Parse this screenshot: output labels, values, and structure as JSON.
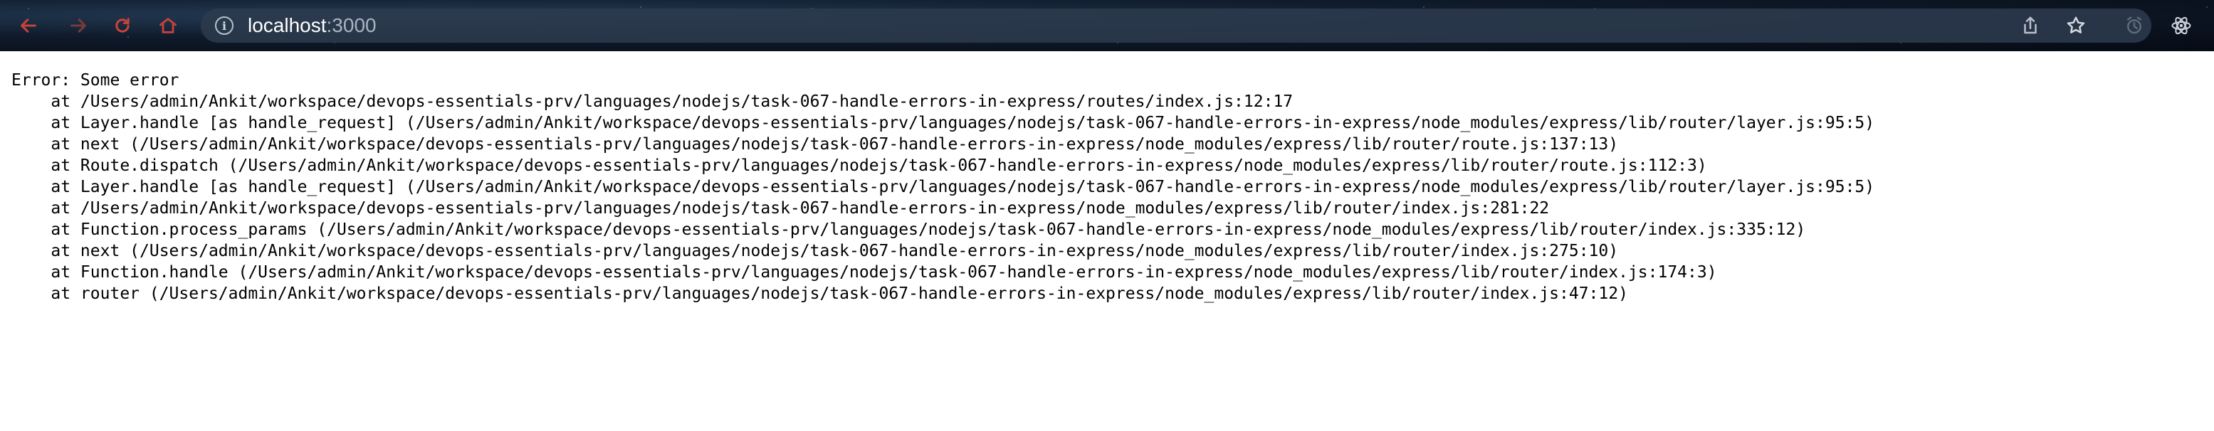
{
  "browser": {
    "url_host": "localhost",
    "url_port": ":3000",
    "icons": [
      "back-icon",
      "forward-icon",
      "reload-icon",
      "home-icon",
      "site-info-icon",
      "share-icon",
      "bookmark-star-icon",
      "extension-icon",
      "react-devtools-icon"
    ],
    "colors": {
      "nav_red": "#c8423a",
      "urlbar_bg": "#2c3a4d",
      "icon_gray": "#b8c0cb"
    }
  },
  "error": {
    "message": "Error: Some error",
    "stack": [
      "    at /Users/admin/Ankit/workspace/devops-essentials-prv/languages/nodejs/task-067-handle-errors-in-express/routes/index.js:12:17",
      "    at Layer.handle [as handle_request] (/Users/admin/Ankit/workspace/devops-essentials-prv/languages/nodejs/task-067-handle-errors-in-express/node_modules/express/lib/router/layer.js:95:5)",
      "    at next (/Users/admin/Ankit/workspace/devops-essentials-prv/languages/nodejs/task-067-handle-errors-in-express/node_modules/express/lib/router/route.js:137:13)",
      "    at Route.dispatch (/Users/admin/Ankit/workspace/devops-essentials-prv/languages/nodejs/task-067-handle-errors-in-express/node_modules/express/lib/router/route.js:112:3)",
      "    at Layer.handle [as handle_request] (/Users/admin/Ankit/workspace/devops-essentials-prv/languages/nodejs/task-067-handle-errors-in-express/node_modules/express/lib/router/layer.js:95:5)",
      "    at /Users/admin/Ankit/workspace/devops-essentials-prv/languages/nodejs/task-067-handle-errors-in-express/node_modules/express/lib/router/index.js:281:22",
      "    at Function.process_params (/Users/admin/Ankit/workspace/devops-essentials-prv/languages/nodejs/task-067-handle-errors-in-express/node_modules/express/lib/router/index.js:335:12)",
      "    at next (/Users/admin/Ankit/workspace/devops-essentials-prv/languages/nodejs/task-067-handle-errors-in-express/node_modules/express/lib/router/index.js:275:10)",
      "    at Function.handle (/Users/admin/Ankit/workspace/devops-essentials-prv/languages/nodejs/task-067-handle-errors-in-express/node_modules/express/lib/router/index.js:174:3)",
      "    at router (/Users/admin/Ankit/workspace/devops-essentials-prv/languages/nodejs/task-067-handle-errors-in-express/node_modules/express/lib/router/index.js:47:12)"
    ]
  }
}
